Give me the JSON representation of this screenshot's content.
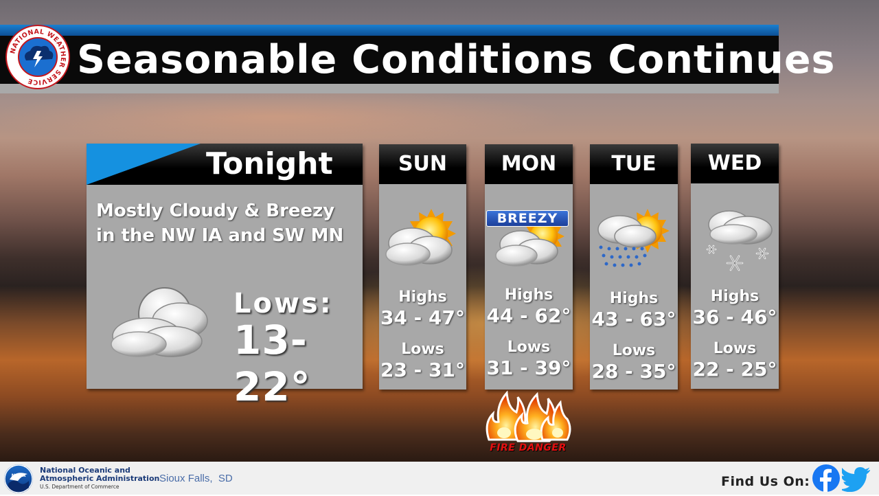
{
  "header": {
    "title": "Seasonable Conditions Continues",
    "logo_text": "NATIONAL WEATHER SERVICE"
  },
  "tonight": {
    "label": "Tonight",
    "description_line1": "Mostly Cloudy & Breezy",
    "description_line2": "in the NW IA and SW MN",
    "lows_label": "Lows:",
    "lows_value": "13-22°",
    "icon": "mostly-cloudy-icon"
  },
  "days": [
    {
      "day": "SUN",
      "icon": "partly-cloudy-icon",
      "highs_label": "Highs",
      "highs": "34 - 47°",
      "lows_label": "Lows",
      "lows": "23 - 31°"
    },
    {
      "day": "MON",
      "icon": "partly-cloudy-icon",
      "badge": "BREEZY",
      "highs_label": "Highs",
      "highs": "44 - 62°",
      "lows_label": "Lows",
      "lows": "31 - 39°"
    },
    {
      "day": "TUE",
      "icon": "rain-sun-icon",
      "highs_label": "Highs",
      "highs": "43 - 63°",
      "lows_label": "Lows",
      "lows": "28 - 35°"
    },
    {
      "day": "WED",
      "icon": "snow-cloud-icon",
      "highs_label": "Highs",
      "highs": "36 - 46°",
      "lows_label": "Lows",
      "lows": "22 - 25°"
    }
  ],
  "fire": {
    "label": "FIRE DANGER"
  },
  "footer": {
    "noaa_logo_text": "NOAA",
    "noaa_name_line1": "National Oceanic and",
    "noaa_name_line2": "Atmospheric Administration",
    "noaa_dept": "U.S. Department of Commerce",
    "office": "Sioux Falls,  SD",
    "find_us": "Find Us On:"
  },
  "colors": {
    "title_blue": "#1a7fd0",
    "panel_gray": "#a8a8a8",
    "header_black": "#000000",
    "fire_red": "#e31010",
    "facebook": "#1877f2",
    "twitter": "#1da1f2"
  }
}
